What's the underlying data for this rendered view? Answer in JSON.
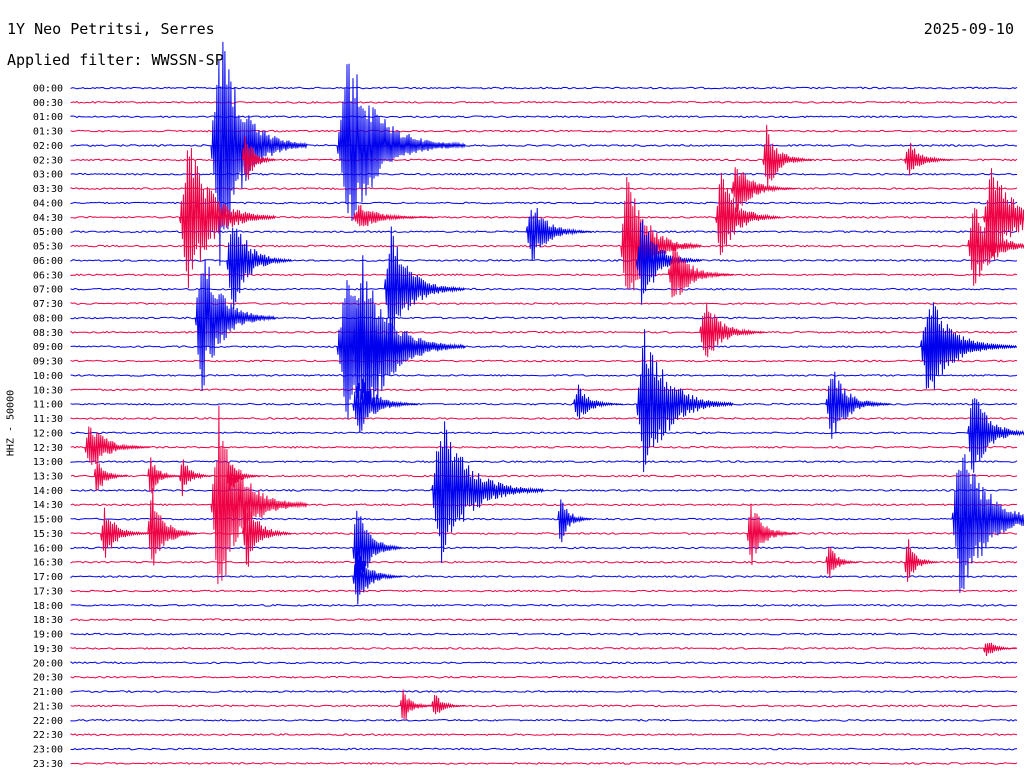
{
  "header": {
    "station": "1Y Neo Petritsi, Serres",
    "date": "2025-09-10",
    "filter": "Applied filter: WWSSN-SP"
  },
  "colors": {
    "trace_a": "#0000ee",
    "trace_b": "#ee0044"
  },
  "chart_data": {
    "type": "seismogram",
    "ylabel": "HHZ - 50000",
    "time_labels": [
      "00:00",
      "00:30",
      "01:00",
      "01:30",
      "02:00",
      "02:30",
      "03:00",
      "03:30",
      "04:00",
      "04:30",
      "05:00",
      "05:30",
      "06:00",
      "06:30",
      "07:00",
      "07:30",
      "08:00",
      "08:30",
      "09:00",
      "09:30",
      "10:00",
      "10:30",
      "11:00",
      "11:30",
      "12:00",
      "12:30",
      "13:00",
      "13:30",
      "14:00",
      "14:30",
      "15:00",
      "15:30",
      "16:00",
      "16:30",
      "17:00",
      "17:30",
      "18:00",
      "18:30",
      "19:00",
      "19:30",
      "20:00",
      "20:30",
      "21:00",
      "21:30",
      "22:00",
      "22:30",
      "23:00",
      "23:30"
    ],
    "row_minutes": 30,
    "events": [
      {
        "row": 4,
        "minute": 4.5,
        "amp": 9.0,
        "dur": 3
      },
      {
        "row": 4,
        "minute": 8.5,
        "amp": 7.0,
        "dur": 4
      },
      {
        "row": 5,
        "minute": 5.5,
        "amp": 2.5,
        "dur": 1
      },
      {
        "row": 5,
        "minute": 22.0,
        "amp": 2.5,
        "dur": 1.5
      },
      {
        "row": 9,
        "minute": 3.5,
        "amp": 6.0,
        "dur": 3
      },
      {
        "row": 9,
        "minute": 9.0,
        "amp": 1.0,
        "dur": 2.5
      },
      {
        "row": 10,
        "minute": 14.5,
        "amp": 2.5,
        "dur": 2
      },
      {
        "row": 9,
        "minute": 20.5,
        "amp": 3.5,
        "dur": 2
      },
      {
        "row": 11,
        "minute": 17.5,
        "amp": 5.5,
        "dur": 2.5
      },
      {
        "row": 11,
        "minute": 28.5,
        "amp": 3.0,
        "dur": 2.5
      },
      {
        "row": 16,
        "minute": 4.0,
        "amp": 5.5,
        "dur": 2.5
      },
      {
        "row": 18,
        "minute": 9.0,
        "amp": 7.0,
        "dur": 3.5
      },
      {
        "row": 17,
        "minute": 20.0,
        "amp": 2.5,
        "dur": 2
      },
      {
        "row": 18,
        "minute": 8.5,
        "amp": 5.5,
        "dur": 3.5
      },
      {
        "row": 18,
        "minute": 27.0,
        "amp": 3.0,
        "dur": 3
      },
      {
        "row": 22,
        "minute": 9.0,
        "amp": 2.5,
        "dur": 2
      },
      {
        "row": 22,
        "minute": 16.0,
        "amp": 1.5,
        "dur": 1.5
      },
      {
        "row": 22,
        "minute": 18.0,
        "amp": 6.0,
        "dur": 3
      },
      {
        "row": 22,
        "minute": 24.0,
        "amp": 3.0,
        "dur": 2
      },
      {
        "row": 24,
        "minute": 28.5,
        "amp": 3.5,
        "dur": 2
      },
      {
        "row": 25,
        "minute": 0.5,
        "amp": 2.0,
        "dur": 2
      },
      {
        "row": 27,
        "minute": 0.8,
        "amp": 1.5,
        "dur": 1
      },
      {
        "row": 27,
        "minute": 2.5,
        "amp": 1.5,
        "dur": 1
      },
      {
        "row": 27,
        "minute": 3.5,
        "amp": 1.5,
        "dur": 1
      },
      {
        "row": 27,
        "minute": 5.0,
        "amp": 1.5,
        "dur": 1
      },
      {
        "row": 28,
        "minute": 11.5,
        "amp": 6.0,
        "dur": 3.5
      },
      {
        "row": 31,
        "minute": 1.0,
        "amp": 2.0,
        "dur": 1.5
      },
      {
        "row": 31,
        "minute": 2.5,
        "amp": 3.5,
        "dur": 1.5
      },
      {
        "row": 31,
        "minute": 5.5,
        "amp": 3.0,
        "dur": 1.5
      },
      {
        "row": 30,
        "minute": 15.5,
        "amp": 2.0,
        "dur": 1
      },
      {
        "row": 31,
        "minute": 21.5,
        "amp": 2.5,
        "dur": 1.5
      },
      {
        "row": 32,
        "minute": 9.0,
        "amp": 4.0,
        "dur": 1.5
      },
      {
        "row": 33,
        "minute": 24.0,
        "amp": 1.5,
        "dur": 1
      },
      {
        "row": 33,
        "minute": 26.5,
        "amp": 2.0,
        "dur": 1
      },
      {
        "row": 34,
        "minute": 9.0,
        "amp": 2.5,
        "dur": 1.5
      },
      {
        "row": 30,
        "minute": 28.0,
        "amp": 6.0,
        "dur": 3.5
      },
      {
        "row": 14,
        "minute": 10.0,
        "amp": 4.5,
        "dur": 2.5
      },
      {
        "row": 12,
        "minute": 5.0,
        "amp": 4.0,
        "dur": 2
      },
      {
        "row": 43,
        "minute": 10.5,
        "amp": 1.5,
        "dur": 1
      },
      {
        "row": 43,
        "minute": 11.5,
        "amp": 1.0,
        "dur": 1
      },
      {
        "row": 39,
        "minute": 29.0,
        "amp": 0.8,
        "dur": 1
      },
      {
        "row": 12,
        "minute": 18.0,
        "amp": 3.5,
        "dur": 2
      },
      {
        "row": 13,
        "minute": 19.0,
        "amp": 2.5,
        "dur": 2
      },
      {
        "row": 9,
        "minute": 29.0,
        "amp": 4.0,
        "dur": 3
      },
      {
        "row": 7,
        "minute": 21.0,
        "amp": 2.0,
        "dur": 2
      },
      {
        "row": 5,
        "minute": 26.5,
        "amp": 1.5,
        "dur": 1.5
      },
      {
        "row": 29,
        "minute": 4.5,
        "amp": 7.0,
        "dur": 3
      },
      {
        "row": 18,
        "minute": 27.0,
        "amp": 4.0,
        "dur": 3
      }
    ]
  }
}
